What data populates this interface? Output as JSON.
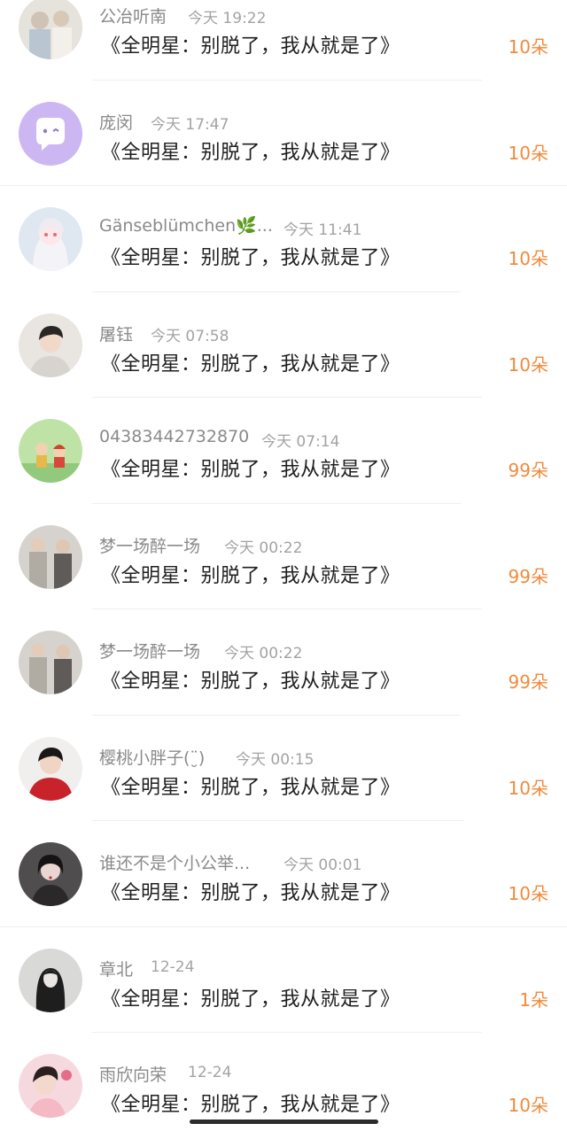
{
  "gift_list": [
    {
      "name": "公冶听南",
      "time": "今天 19:22",
      "title": "《全明星：别脱了，我从就是了》",
      "count": "10朵",
      "avatar": "avatar-couple-photo"
    },
    {
      "name": "庞闵",
      "time": "今天 17:47",
      "title": "《全明星：别脱了，我从就是了》",
      "count": "10朵",
      "avatar": "avatar-purple-chat-bubble"
    },
    {
      "name": "Gänseblümchen🌿...",
      "time": "今天 11:41",
      "title": "《全明星：别脱了，我从就是了》",
      "count": "10朵",
      "avatar": "avatar-anime-girl"
    },
    {
      "name": "屠钰",
      "time": "今天 07:58",
      "title": "《全明星：别脱了，我从就是了》",
      "count": "10朵",
      "avatar": "avatar-young-man"
    },
    {
      "name": "04383442732870",
      "time": "今天 07:14",
      "title": "《全明星：别脱了，我从就是了》",
      "count": "99朵",
      "avatar": "avatar-cartoon-kids"
    },
    {
      "name": "梦一场醉一场",
      "time": "今天 00:22",
      "title": "《全明星：别脱了，我从就是了》",
      "count": "99朵",
      "avatar": "avatar-two-men"
    },
    {
      "name": "梦一场醉一场",
      "time": "今天 00:22",
      "title": "《全明星：别脱了，我从就是了》",
      "count": "99朵",
      "avatar": "avatar-two-men"
    },
    {
      "name": "樱桃小胖子(¨̮)",
      "time": "今天 00:15",
      "title": "《全明星：别脱了，我从就是了》",
      "count": "10朵",
      "avatar": "avatar-man-red-shirt"
    },
    {
      "name": "谁还不是个小公举...",
      "time": "今天 00:01",
      "title": "《全明星：别脱了，我从就是了》",
      "count": "10朵",
      "avatar": "avatar-dark-girl"
    },
    {
      "name": "章北",
      "time": "12-24",
      "title": "《全明星：别脱了，我从就是了》",
      "count": "1朵",
      "avatar": "avatar-long-hair-girl"
    },
    {
      "name": "雨欣向荣",
      "time": "12-24",
      "title": "《全明星：别脱了，我从就是了》",
      "count": "10朵",
      "avatar": "avatar-pink-girl"
    }
  ],
  "colors": {
    "accent": "#f08a3c",
    "name": "#8a8a8a",
    "time": "#a3a3a3",
    "title": "#1f1f1f"
  }
}
